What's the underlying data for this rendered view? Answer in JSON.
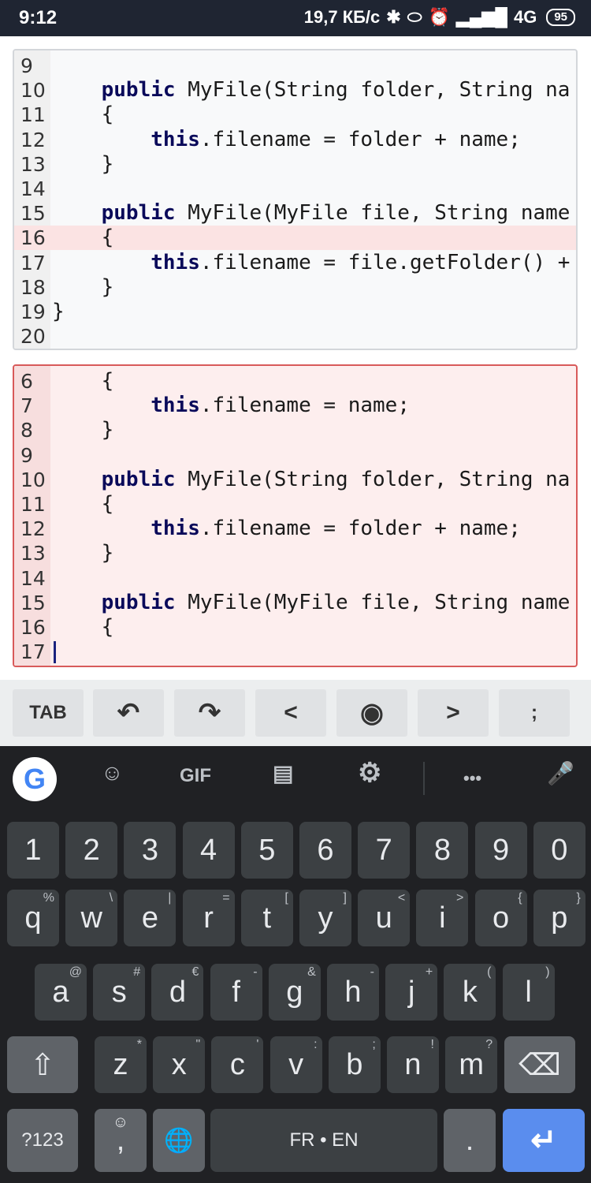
{
  "status": {
    "time": "9:12",
    "speed": "19,7 КБ/с",
    "network": "4G",
    "battery": "95",
    "icons": [
      "bluetooth-icon",
      "toggle-icon",
      "alarm-icon",
      "signal-icon"
    ]
  },
  "top_pane": {
    "lines": [
      {
        "n": "9",
        "code": ""
      },
      {
        "n": "10",
        "code": "    public MyFile(String folder, String na"
      },
      {
        "n": "11",
        "code": "    {"
      },
      {
        "n": "12",
        "code": "        this.filename = folder + name;"
      },
      {
        "n": "13",
        "code": "    }"
      },
      {
        "n": "14",
        "code": ""
      },
      {
        "n": "15",
        "code": "    public MyFile(MyFile file, String name"
      },
      {
        "n": "16",
        "code": "    {"
      },
      {
        "n": "17",
        "code": "        this.filename = file.getFolder() +"
      },
      {
        "n": "18",
        "code": "    }"
      },
      {
        "n": "19",
        "code": "}"
      },
      {
        "n": "20",
        "code": ""
      }
    ]
  },
  "bottom_pane": {
    "lines": [
      {
        "n": "6",
        "code": "    {"
      },
      {
        "n": "7",
        "code": "        this.filename = name;"
      },
      {
        "n": "8",
        "code": "    }"
      },
      {
        "n": "9",
        "code": ""
      },
      {
        "n": "10",
        "code": "    public MyFile(String folder, String na"
      },
      {
        "n": "11",
        "code": "    {"
      },
      {
        "n": "12",
        "code": "        this.filename = folder + name;"
      },
      {
        "n": "13",
        "code": "    }"
      },
      {
        "n": "14",
        "code": ""
      },
      {
        "n": "15",
        "code": "    public MyFile(MyFile file, String name"
      },
      {
        "n": "16",
        "code": "    {"
      },
      {
        "n": "17",
        "code": ""
      }
    ]
  },
  "toolbar": {
    "tab": "TAB",
    "undo_icon": "↶",
    "redo_icon": "↷",
    "left": "<",
    "circle_icon": "◉",
    "right": ">",
    "semicolon": ";"
  },
  "keyboard": {
    "suggestions": {
      "google": "G",
      "sticker": "☺",
      "gif": "GIF",
      "clipboard": "▤",
      "settings": "⚙",
      "more": "•••",
      "mic": "🎤"
    },
    "row_numbers": [
      "1",
      "2",
      "3",
      "4",
      "5",
      "6",
      "7",
      "8",
      "9",
      "0"
    ],
    "row1": [
      {
        "k": "q",
        "s": "%"
      },
      {
        "k": "w",
        "s": "\\"
      },
      {
        "k": "e",
        "s": "|"
      },
      {
        "k": "r",
        "s": "="
      },
      {
        "k": "t",
        "s": "["
      },
      {
        "k": "y",
        "s": "]"
      },
      {
        "k": "u",
        "s": "<"
      },
      {
        "k": "i",
        "s": ">"
      },
      {
        "k": "o",
        "s": "{"
      },
      {
        "k": "p",
        "s": "}"
      }
    ],
    "row2": [
      {
        "k": "a",
        "s": "@"
      },
      {
        "k": "s",
        "s": "#"
      },
      {
        "k": "d",
        "s": "€"
      },
      {
        "k": "f",
        "s": "-"
      },
      {
        "k": "g",
        "s": "&"
      },
      {
        "k": "h",
        "s": "-"
      },
      {
        "k": "j",
        "s": "+"
      },
      {
        "k": "k",
        "s": "("
      },
      {
        "k": "l",
        "s": ")"
      }
    ],
    "row3": [
      {
        "k": "z",
        "s": "*"
      },
      {
        "k": "x",
        "s": "\""
      },
      {
        "k": "c",
        "s": "'"
      },
      {
        "k": "v",
        "s": ":"
      },
      {
        "k": "b",
        "s": ";"
      },
      {
        "k": "n",
        "s": "!"
      },
      {
        "k": "m",
        "s": "?"
      }
    ],
    "shift": "⇧",
    "backspace": "⌫",
    "sym": "?123",
    "emoji": "☺",
    "comma": ",",
    "globe": "🌐",
    "space": "FR • EN",
    "period": ".",
    "enter": "↵"
  }
}
